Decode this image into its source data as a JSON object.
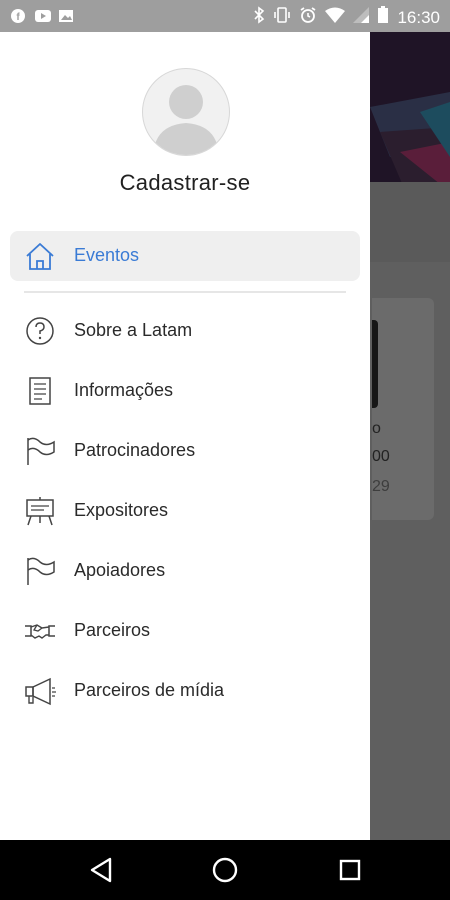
{
  "status_bar": {
    "time": "16:30",
    "left_icons": [
      "facebook-icon",
      "youtube-icon",
      "image-icon"
    ],
    "right_icons": [
      "bluetooth-icon",
      "vibrate-icon",
      "alarm-icon",
      "wifi-icon",
      "signal-icon",
      "battery-icon"
    ]
  },
  "drawer": {
    "profile_name": "Cadastrar-se",
    "items": [
      {
        "label": "Eventos",
        "icon": "home-icon",
        "active": true
      },
      {
        "label": "Sobre a Latam",
        "icon": "help-circle-icon"
      },
      {
        "label": "Informações",
        "icon": "document-icon"
      },
      {
        "label": "Patrocinadores",
        "icon": "flag-icon"
      },
      {
        "label": "Expositores",
        "icon": "easel-icon"
      },
      {
        "label": "Apoiadores",
        "icon": "flag-icon"
      },
      {
        "label": "Parceiros",
        "icon": "handshake-icon"
      },
      {
        "label": "Parceiros de mídia",
        "icon": "megaphone-icon"
      }
    ]
  },
  "background_card": {
    "line1": "o",
    "line2": "00",
    "line3": "29"
  },
  "colors": {
    "accent": "#3a7bd5",
    "drawer_bg": "#ffffff",
    "scrim": "#5f5f5f",
    "status_bar": "#9e9e9e"
  }
}
